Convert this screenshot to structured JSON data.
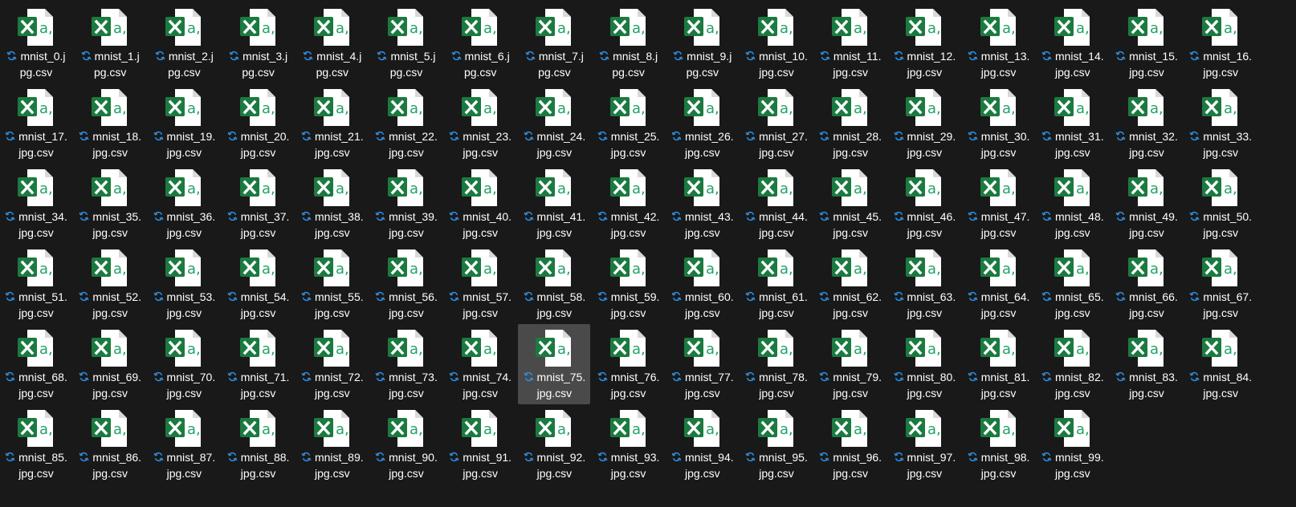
{
  "colors": {
    "background": "#191919",
    "selected_tile": "#4a4a4a",
    "label_text": "#ffffff",
    "sync_icon": "#2f8fe0",
    "excel_green": "#1b7a40",
    "excel_accent": "#21a366"
  },
  "icons": {
    "file": "excel-csv-file-icon",
    "status": "sync-pending-icon"
  },
  "selected_file": "mnist_75.jpg.csv",
  "files": [
    {
      "line1": "mnist_0.j",
      "line2": "pg.csv"
    },
    {
      "line1": "mnist_1.j",
      "line2": "pg.csv"
    },
    {
      "line1": "mnist_2.j",
      "line2": "pg.csv"
    },
    {
      "line1": "mnist_3.j",
      "line2": "pg.csv"
    },
    {
      "line1": "mnist_4.j",
      "line2": "pg.csv"
    },
    {
      "line1": "mnist_5.j",
      "line2": "pg.csv"
    },
    {
      "line1": "mnist_6.j",
      "line2": "pg.csv"
    },
    {
      "line1": "mnist_7.j",
      "line2": "pg.csv"
    },
    {
      "line1": "mnist_8.j",
      "line2": "pg.csv"
    },
    {
      "line1": "mnist_9.j",
      "line2": "pg.csv"
    },
    {
      "line1": "mnist_10.",
      "line2": "jpg.csv"
    },
    {
      "line1": "mnist_11.",
      "line2": "jpg.csv"
    },
    {
      "line1": "mnist_12.",
      "line2": "jpg.csv"
    },
    {
      "line1": "mnist_13.",
      "line2": "jpg.csv"
    },
    {
      "line1": "mnist_14.",
      "line2": "jpg.csv"
    },
    {
      "line1": "mnist_15.",
      "line2": "jpg.csv"
    },
    {
      "line1": "mnist_16.",
      "line2": "jpg.csv"
    },
    {
      "line1": "mnist_17.",
      "line2": "jpg.csv"
    },
    {
      "line1": "mnist_18.",
      "line2": "jpg.csv"
    },
    {
      "line1": "mnist_19.",
      "line2": "jpg.csv"
    },
    {
      "line1": "mnist_20.",
      "line2": "jpg.csv"
    },
    {
      "line1": "mnist_21.",
      "line2": "jpg.csv"
    },
    {
      "line1": "mnist_22.",
      "line2": "jpg.csv"
    },
    {
      "line1": "mnist_23.",
      "line2": "jpg.csv"
    },
    {
      "line1": "mnist_24.",
      "line2": "jpg.csv"
    },
    {
      "line1": "mnist_25.",
      "line2": "jpg.csv"
    },
    {
      "line1": "mnist_26.",
      "line2": "jpg.csv"
    },
    {
      "line1": "mnist_27.",
      "line2": "jpg.csv"
    },
    {
      "line1": "mnist_28.",
      "line2": "jpg.csv"
    },
    {
      "line1": "mnist_29.",
      "line2": "jpg.csv"
    },
    {
      "line1": "mnist_30.",
      "line2": "jpg.csv"
    },
    {
      "line1": "mnist_31.",
      "line2": "jpg.csv"
    },
    {
      "line1": "mnist_32.",
      "line2": "jpg.csv"
    },
    {
      "line1": "mnist_33.",
      "line2": "jpg.csv"
    },
    {
      "line1": "mnist_34.",
      "line2": "jpg.csv"
    },
    {
      "line1": "mnist_35.",
      "line2": "jpg.csv"
    },
    {
      "line1": "mnist_36.",
      "line2": "jpg.csv"
    },
    {
      "line1": "mnist_37.",
      "line2": "jpg.csv"
    },
    {
      "line1": "mnist_38.",
      "line2": "jpg.csv"
    },
    {
      "line1": "mnist_39.",
      "line2": "jpg.csv"
    },
    {
      "line1": "mnist_40.",
      "line2": "jpg.csv"
    },
    {
      "line1": "mnist_41.",
      "line2": "jpg.csv"
    },
    {
      "line1": "mnist_42.",
      "line2": "jpg.csv"
    },
    {
      "line1": "mnist_43.",
      "line2": "jpg.csv"
    },
    {
      "line1": "mnist_44.",
      "line2": "jpg.csv"
    },
    {
      "line1": "mnist_45.",
      "line2": "jpg.csv"
    },
    {
      "line1": "mnist_46.",
      "line2": "jpg.csv"
    },
    {
      "line1": "mnist_47.",
      "line2": "jpg.csv"
    },
    {
      "line1": "mnist_48.",
      "line2": "jpg.csv"
    },
    {
      "line1": "mnist_49.",
      "line2": "jpg.csv"
    },
    {
      "line1": "mnist_50.",
      "line2": "jpg.csv"
    },
    {
      "line1": "mnist_51.",
      "line2": "jpg.csv"
    },
    {
      "line1": "mnist_52.",
      "line2": "jpg.csv"
    },
    {
      "line1": "mnist_53.",
      "line2": "jpg.csv"
    },
    {
      "line1": "mnist_54.",
      "line2": "jpg.csv"
    },
    {
      "line1": "mnist_55.",
      "line2": "jpg.csv"
    },
    {
      "line1": "mnist_56.",
      "line2": "jpg.csv"
    },
    {
      "line1": "mnist_57.",
      "line2": "jpg.csv"
    },
    {
      "line1": "mnist_58.",
      "line2": "jpg.csv"
    },
    {
      "line1": "mnist_59.",
      "line2": "jpg.csv"
    },
    {
      "line1": "mnist_60.",
      "line2": "jpg.csv"
    },
    {
      "line1": "mnist_61.",
      "line2": "jpg.csv"
    },
    {
      "line1": "mnist_62.",
      "line2": "jpg.csv"
    },
    {
      "line1": "mnist_63.",
      "line2": "jpg.csv"
    },
    {
      "line1": "mnist_64.",
      "line2": "jpg.csv"
    },
    {
      "line1": "mnist_65.",
      "line2": "jpg.csv"
    },
    {
      "line1": "mnist_66.",
      "line2": "jpg.csv"
    },
    {
      "line1": "mnist_67.",
      "line2": "jpg.csv"
    },
    {
      "line1": "mnist_68.",
      "line2": "jpg.csv"
    },
    {
      "line1": "mnist_69.",
      "line2": "jpg.csv"
    },
    {
      "line1": "mnist_70.",
      "line2": "jpg.csv"
    },
    {
      "line1": "mnist_71.",
      "line2": "jpg.csv"
    },
    {
      "line1": "mnist_72.",
      "line2": "jpg.csv"
    },
    {
      "line1": "mnist_73.",
      "line2": "jpg.csv"
    },
    {
      "line1": "mnist_74.",
      "line2": "jpg.csv"
    },
    {
      "line1": "mnist_75.",
      "line2": "jpg.csv"
    },
    {
      "line1": "mnist_76.",
      "line2": "jpg.csv"
    },
    {
      "line1": "mnist_77.",
      "line2": "jpg.csv"
    },
    {
      "line1": "mnist_78.",
      "line2": "jpg.csv"
    },
    {
      "line1": "mnist_79.",
      "line2": "jpg.csv"
    },
    {
      "line1": "mnist_80.",
      "line2": "jpg.csv"
    },
    {
      "line1": "mnist_81.",
      "line2": "jpg.csv"
    },
    {
      "line1": "mnist_82.",
      "line2": "jpg.csv"
    },
    {
      "line1": "mnist_83.",
      "line2": "jpg.csv"
    },
    {
      "line1": "mnist_84.",
      "line2": "jpg.csv"
    },
    {
      "line1": "mnist_85.",
      "line2": "jpg.csv"
    },
    {
      "line1": "mnist_86.",
      "line2": "jpg.csv"
    },
    {
      "line1": "mnist_87.",
      "line2": "jpg.csv"
    },
    {
      "line1": "mnist_88.",
      "line2": "jpg.csv"
    },
    {
      "line1": "mnist_89.",
      "line2": "jpg.csv"
    },
    {
      "line1": "mnist_90.",
      "line2": "jpg.csv"
    },
    {
      "line1": "mnist_91.",
      "line2": "jpg.csv"
    },
    {
      "line1": "mnist_92.",
      "line2": "jpg.csv"
    },
    {
      "line1": "mnist_93.",
      "line2": "jpg.csv"
    },
    {
      "line1": "mnist_94.",
      "line2": "jpg.csv"
    },
    {
      "line1": "mnist_95.",
      "line2": "jpg.csv"
    },
    {
      "line1": "mnist_96.",
      "line2": "jpg.csv"
    },
    {
      "line1": "mnist_97.",
      "line2": "jpg.csv"
    },
    {
      "line1": "mnist_98.",
      "line2": "jpg.csv"
    },
    {
      "line1": "mnist_99.",
      "line2": "jpg.csv"
    }
  ]
}
